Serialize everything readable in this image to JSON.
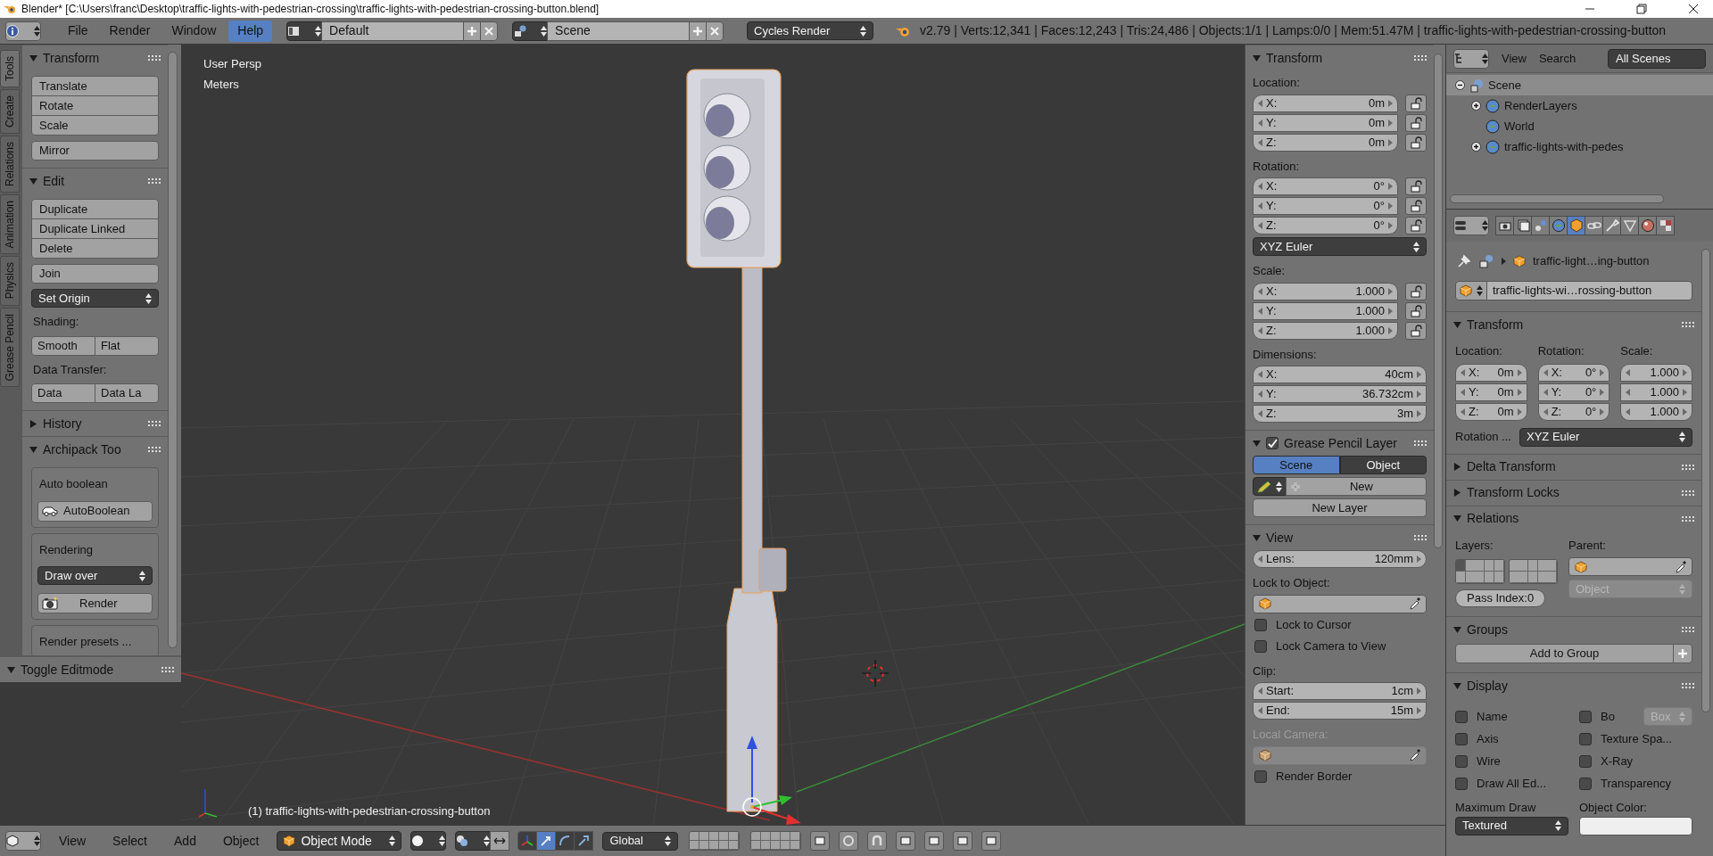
{
  "title_bar": {
    "title": "Blender* [C:\\Users\\franc\\Desktop\\traffic-lights-with-pedestrian-crossing\\traffic-lights-with-pedestrian-crossing-button.blend]"
  },
  "info_header": {
    "menus": [
      {
        "label": "File",
        "selected": false
      },
      {
        "label": "Render",
        "selected": false
      },
      {
        "label": "Window",
        "selected": false
      },
      {
        "label": "Help",
        "selected": true
      }
    ],
    "screen_layout": "Default",
    "scene": "Scene",
    "render_engine": "Cycles Render",
    "stats": "v2.79 | Verts:12,341 | Faces:12,243 | Tris:24,486 | Objects:1/1 | Lamps:0/0 | Mem:51.47M | traffic-lights-with-pedestrian-crossing-button"
  },
  "tool_tabs": [
    {
      "label": "Tools",
      "selected": true
    },
    {
      "label": "Create",
      "selected": false
    },
    {
      "label": "Relations",
      "selected": false
    },
    {
      "label": "Animation",
      "selected": false
    },
    {
      "label": "Physics",
      "selected": false
    },
    {
      "label": "Grease Pencil",
      "selected": false
    }
  ],
  "tool_shelf": {
    "panels": [
      {
        "title": "Transform",
        "expanded": true,
        "items": [
          {
            "kind": "column",
            "labels": [
              "Translate",
              "Rotate",
              "Scale"
            ]
          },
          {
            "kind": "button",
            "label": "Mirror"
          }
        ]
      },
      {
        "title": "Edit",
        "expanded": true,
        "items": [
          {
            "kind": "column",
            "labels": [
              "Duplicate",
              "Duplicate Linked",
              "Delete"
            ]
          },
          {
            "kind": "button",
            "label": "Join"
          },
          {
            "kind": "dropdown",
            "label": "Set Origin"
          },
          {
            "kind": "label",
            "label": "Shading:"
          },
          {
            "kind": "row",
            "labels": [
              "Smooth",
              "Flat"
            ]
          },
          {
            "kind": "label",
            "label": "Data Transfer:"
          },
          {
            "kind": "row",
            "labels": [
              "Data",
              "Data La"
            ]
          }
        ]
      },
      {
        "title": "History",
        "expanded": false
      },
      {
        "title": "Archipack Too",
        "expanded": true,
        "items": [
          {
            "kind": "box",
            "items": [
              {
                "kind": "label",
                "label": "Auto boolean"
              },
              {
                "kind": "toolbutton",
                "label": "AutoBoolean"
              }
            ]
          },
          {
            "kind": "box",
            "items": [
              {
                "kind": "label",
                "label": "Rendering"
              },
              {
                "kind": "dropdown",
                "label": "Draw over"
              },
              {
                "kind": "toolbutton",
                "label": "Render"
              }
            ]
          },
          {
            "kind": "box",
            "items": [
              {
                "kind": "label",
                "label": "Render presets ..."
              }
            ]
          }
        ]
      }
    ]
  },
  "operator_panel": {
    "title": "Toggle Editmode",
    "expanded": true
  },
  "viewport": {
    "view_name": "User Persp",
    "units": "Meters",
    "object_info": "(1) traffic-lights-with-pedestrian-crossing-button"
  },
  "n_panel": {
    "panels": [
      {
        "title": "Transform",
        "expanded": true,
        "items": [
          {
            "kind": "label",
            "label": "Location:",
            "disabled": false
          },
          {
            "kind": "vector",
            "fields": [
              {
                "axis": "X:",
                "value": "0m",
                "locked": false
              },
              {
                "axis": "Y:",
                "value": "0m",
                "locked": false
              },
              {
                "axis": "Z:",
                "value": "0m",
                "locked": false
              }
            ]
          },
          {
            "kind": "label",
            "label": "Rotation:",
            "disabled": false
          },
          {
            "kind": "vector",
            "fields": [
              {
                "axis": "X:",
                "value": "0°",
                "locked": false
              },
              {
                "axis": "Y:",
                "value": "0°",
                "locked": false
              },
              {
                "axis": "Z:",
                "value": "0°",
                "locked": false
              }
            ]
          },
          {
            "kind": "dropdown",
            "label": "XYZ Euler"
          },
          {
            "kind": "label",
            "label": "Scale:",
            "disabled": false
          },
          {
            "kind": "vector",
            "fields": [
              {
                "axis": "X:",
                "value": "1.000",
                "locked": false
              },
              {
                "axis": "Y:",
                "value": "1.000",
                "locked": false
              },
              {
                "axis": "Z:",
                "value": "1.000",
                "locked": false
              }
            ]
          },
          {
            "kind": "label",
            "label": "Dimensions:",
            "disabled": false
          },
          {
            "kind": "vector",
            "fields": [
              {
                "axis": "X:",
                "value": "40cm"
              },
              {
                "axis": "Y:",
                "value": "36.732cm"
              },
              {
                "axis": "Z:",
                "value": "3m"
              }
            ]
          }
        ]
      },
      {
        "title": "Grease Pencil Layer",
        "expanded": true,
        "checked": true,
        "items": [
          {
            "kind": "tabs",
            "options": [
              {
                "label": "Scene",
                "selected": true
              },
              {
                "label": "Object",
                "selected": false
              }
            ]
          },
          {
            "kind": "pencilnew",
            "label": "New"
          },
          {
            "kind": "button",
            "label": "New Layer"
          }
        ]
      },
      {
        "title": "View",
        "expanded": true,
        "items": [
          {
            "kind": "vector",
            "fields": [
              {
                "axis": "Lens:",
                "value": "120mm"
              }
            ]
          },
          {
            "kind": "label",
            "label": "Lock to Object:",
            "disabled": false
          },
          {
            "kind": "objectfield",
            "disabled": false
          },
          {
            "kind": "checkbox",
            "label": "Lock to Cursor",
            "checked": false
          },
          {
            "kind": "checkbox",
            "label": "Lock Camera to View",
            "checked": false
          },
          {
            "kind": "label",
            "label": "Clip:",
            "disabled": false
          },
          {
            "kind": "vector",
            "fields": [
              {
                "axis": "Start:",
                "value": "1cm"
              },
              {
                "axis": "End:",
                "value": "15m"
              }
            ]
          },
          {
            "kind": "label",
            "label": "Local Camera:",
            "disabled": true
          },
          {
            "kind": "objectfield",
            "disabled": true
          },
          {
            "kind": "checkbox",
            "label": "Render Border",
            "checked": false
          }
        ]
      }
    ]
  },
  "outliner": {
    "menus": [
      "View",
      "Search"
    ],
    "display_mode": "All Scenes",
    "tree": [
      {
        "label": "Scene",
        "expanded": true,
        "selected": true,
        "children": [
          {
            "label": "RenderLayers",
            "expanded": false,
            "selected": false
          },
          {
            "label": "World",
            "selected": false
          },
          {
            "label": "traffic-lights-with-pedes",
            "expanded": false,
            "selected": false
          }
        ]
      }
    ]
  },
  "properties": {
    "context_tabs": [
      {
        "selected": false
      },
      {
        "selected": false
      },
      {
        "selected": false
      },
      {
        "selected": false
      },
      {
        "selected": true
      },
      {
        "selected": false
      },
      {
        "selected": false
      },
      {
        "selected": false
      },
      {
        "selected": false
      },
      {
        "selected": false
      }
    ],
    "breadcrumb": "traffic-light…ing-button",
    "object_name": "traffic-lights-wi…rossing-button",
    "panels": [
      {
        "kind": "transform",
        "title": "Transform",
        "expanded": true,
        "columns": [
          {
            "label": "Location:",
            "fields": [
              {
                "axis": "X:",
                "value": "0m"
              },
              {
                "axis": "Y:",
                "value": "0m"
              },
              {
                "axis": "Z:",
                "value": "0m"
              }
            ]
          },
          {
            "label": "Rotation:",
            "fields": [
              {
                "axis": "X:",
                "value": "0°"
              },
              {
                "axis": "Y:",
                "value": "0°"
              },
              {
                "axis": "Z:",
                "value": "0°"
              }
            ]
          },
          {
            "label": "Scale:",
            "fields": [
              {
                "value": "1.000"
              },
              {
                "value": "1.000"
              },
              {
                "value": "1.000"
              }
            ]
          }
        ],
        "rotation_mode_label": "Rotation ...",
        "rotation_mode": "XYZ Euler"
      },
      {
        "title": "Delta Transform",
        "expanded": false
      },
      {
        "title": "Transform Locks",
        "expanded": false
      },
      {
        "kind": "relations",
        "title": "Relations",
        "expanded": true,
        "layers_label": "Layers:",
        "parent_label": "Parent:",
        "parent_type": "Object",
        "pass_index": "Pass Index:0",
        "layers": [
          {
            "on": true
          },
          {
            "on": false
          },
          {
            "on": false
          },
          {
            "on": false
          },
          {
            "on": false
          },
          {
            "on": false
          },
          {
            "on": false
          },
          {
            "on": false
          },
          {
            "on": false
          },
          {
            "on": false
          },
          {
            "on": false
          },
          {
            "on": false
          },
          {
            "on": false
          },
          {
            "on": false
          },
          {
            "on": false
          },
          {
            "on": false
          },
          {
            "on": false
          },
          {
            "on": false
          },
          {
            "on": false
          },
          {
            "on": false
          }
        ]
      },
      {
        "kind": "groups",
        "title": "Groups",
        "expanded": true,
        "button": "Add to Group"
      },
      {
        "kind": "display",
        "title": "Display",
        "expanded": true,
        "checkboxes": [
          {
            "label": "Name",
            "checked": false
          },
          {
            "label": "Bo",
            "checked": false
          },
          {
            "label": "Axis",
            "checked": false
          },
          {
            "label": "Texture Spa...",
            "checked": false
          },
          {
            "label": "Wire",
            "checked": false
          },
          {
            "label": "X-Ray",
            "checked": false
          },
          {
            "label": "Draw All Ed...",
            "checked": false
          },
          {
            "label": "Transparency",
            "checked": false
          }
        ],
        "bounds_type": "Box",
        "max_draw_label": "Maximum Draw",
        "color_label": "Object Color:",
        "max_draw": "Textured"
      }
    ]
  },
  "view3d_header": {
    "menus": [
      "View",
      "Select",
      "Add",
      "Object"
    ],
    "mode": "Object Mode",
    "orientation": "Global",
    "manipulators": [
      {
        "selected": false
      },
      {
        "selected": true
      },
      {
        "selected": false
      },
      {
        "selected": false
      }
    ]
  }
}
